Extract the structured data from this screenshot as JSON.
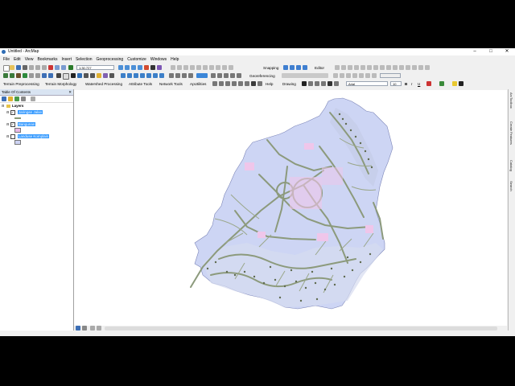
{
  "window": {
    "title": "Untitled - ArcMap",
    "minimize": "–",
    "maximize": "□",
    "close": "✕"
  },
  "menu": [
    "File",
    "Edit",
    "View",
    "Bookmarks",
    "Insert",
    "Selection",
    "Geoprocessing",
    "Customize",
    "Windows",
    "Help"
  ],
  "toolbar1": {
    "scale": "1:30.727",
    "snapping": "Snapping",
    "editor": "Editor"
  },
  "toolbar2": {
    "georeferencing": "Georeferencing"
  },
  "toolbar3": {
    "items": [
      "Terrain Preprocessing",
      "Terrain Morphology",
      "Watershed Processing",
      "Attribute Tools",
      "Network Tools",
      "ApUtilities"
    ],
    "help": "Help",
    "drawing": "Drawing",
    "font": "Arial",
    "font_size": "10",
    "bold": "B",
    "italic": "I",
    "underline": "U"
  },
  "toc": {
    "title": "Table Of Contents",
    "group": "Layers",
    "layers": [
      {
        "name": "Jaringan Jalan",
        "checked": true,
        "symbol_color": "#8a9a7a"
      },
      {
        "name": "Bangunan",
        "checked": true,
        "symbol_color": "#e9b7e6"
      },
      {
        "name": "Landuse Komplain",
        "checked": false,
        "symbol_color": "#cdd3f3"
      }
    ]
  },
  "right_dock": [
    "ArcToolbox",
    "Create Features",
    "Catalog",
    "Search"
  ],
  "colors": {
    "landuse": "#cdd5f4",
    "roads": "#8c9a7c",
    "buildings": "#efc6ea",
    "selection": "#3399ff"
  }
}
